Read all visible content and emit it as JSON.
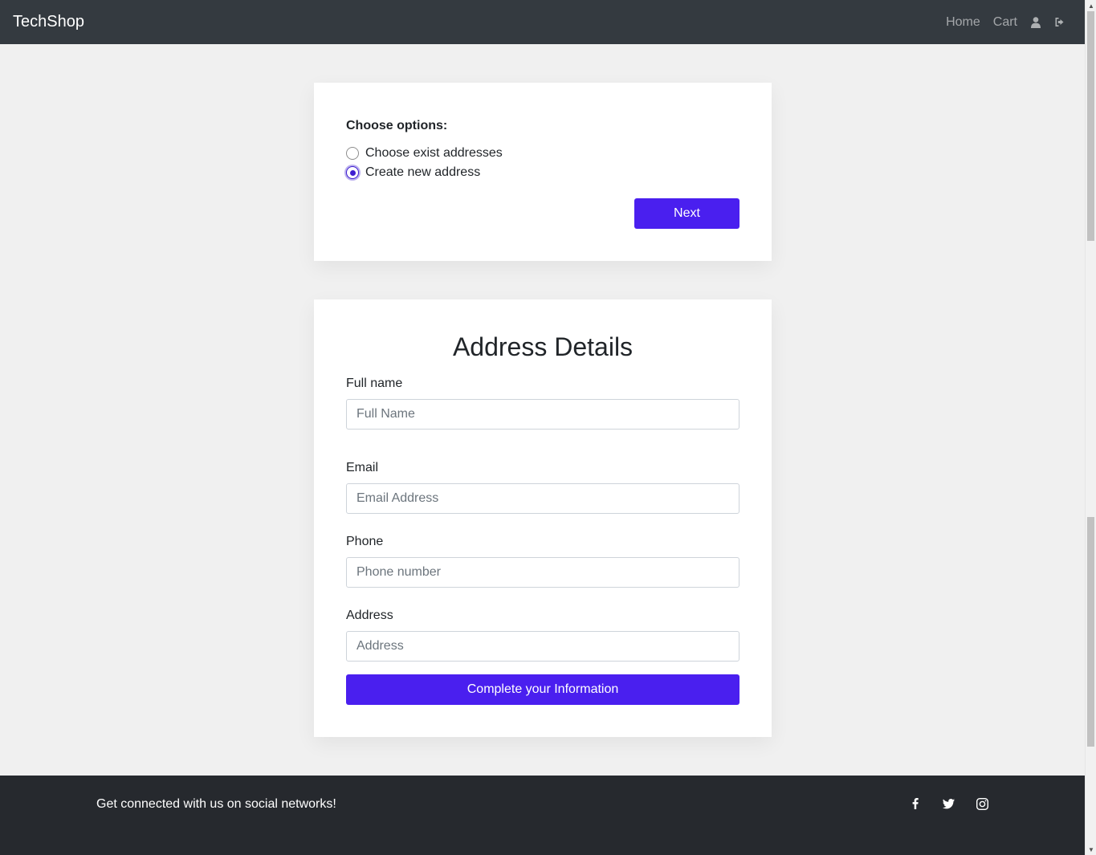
{
  "navbar": {
    "brand": "TechShop",
    "links": [
      "Home",
      "Cart"
    ],
    "icons": [
      "user-icon",
      "sign-out-icon"
    ]
  },
  "options": {
    "title": "Choose options:",
    "radios": [
      {
        "label": "Choose exist addresses",
        "checked": false
      },
      {
        "label": "Create new address",
        "checked": true
      }
    ],
    "next_label": "Next"
  },
  "address_form": {
    "title": "Address Details",
    "fields": [
      {
        "label": "Full name",
        "placeholder": "Full Name",
        "value": ""
      },
      {
        "label": "Email",
        "placeholder": "Email Address",
        "value": ""
      },
      {
        "label": "Phone",
        "placeholder": "Phone number",
        "value": ""
      },
      {
        "label": "Address",
        "placeholder": "Address",
        "value": ""
      }
    ],
    "submit_label": "Complete your Information"
  },
  "footer": {
    "text": "Get connected with us on social networks!",
    "icons": [
      "facebook-icon",
      "twitter-icon",
      "instagram-icon"
    ]
  },
  "colors": {
    "navbar": "#343a40",
    "primary_button": "#4a1fef",
    "footer": "#26292e",
    "background": "#f0f0f0"
  }
}
